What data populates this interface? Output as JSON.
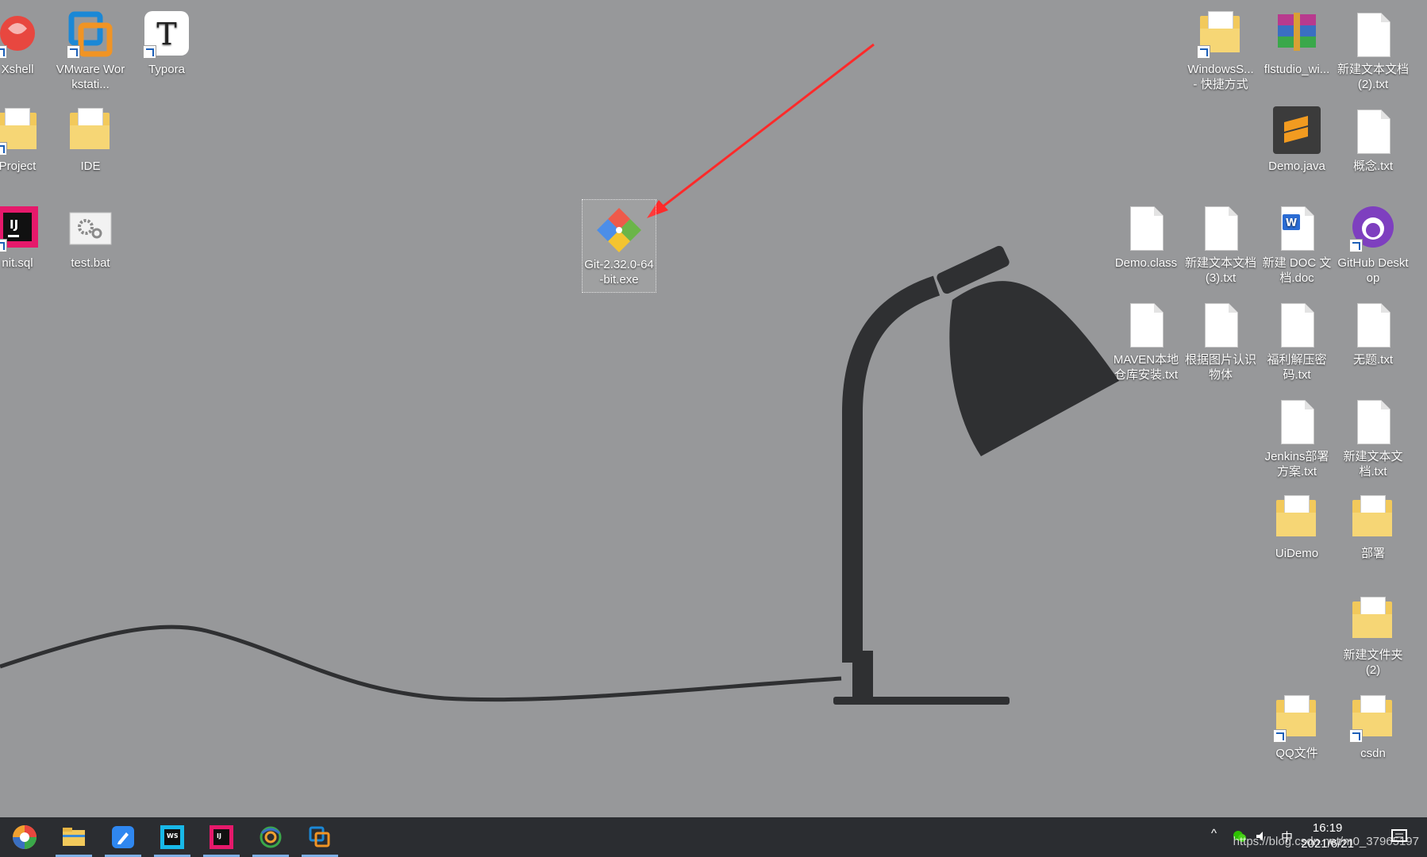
{
  "desktop": {
    "left_icons": [
      {
        "label": "Xshell",
        "icon": "xshell-icon"
      },
      {
        "label": "VMware Workstati...",
        "icon": "vmware-icon"
      },
      {
        "label": "Typora",
        "icon": "typora-icon"
      },
      {
        "label": "Project",
        "icon": "folder-icon"
      },
      {
        "label": "IDE",
        "icon": "folder-icon"
      },
      {
        "label": "nit.sql",
        "icon": "intellij-icon"
      },
      {
        "label": "test.bat",
        "icon": "gear-file-icon"
      }
    ],
    "center_icon": {
      "label": "Git-2.32.0-64-bit.exe",
      "icon": "git-installer-icon"
    },
    "right_icons": [
      {
        "label": "WindowsS... - 快捷方式",
        "icon": "folder-shortcut-icon"
      },
      {
        "label": "flstudio_wi...",
        "icon": "winrar-archive-icon"
      },
      {
        "label": "新建文本文档 (2).txt",
        "icon": "text-file-icon"
      },
      {
        "label": "Demo.java",
        "icon": "sublime-icon"
      },
      {
        "label": "概念.txt",
        "icon": "text-file-icon"
      },
      {
        "label": "Demo.class",
        "icon": "blank-file-icon"
      },
      {
        "label": "新建文本文档 (3).txt",
        "icon": "text-file-icon"
      },
      {
        "label": "新建 DOC 文档.doc",
        "icon": "word-doc-icon"
      },
      {
        "label": "GitHub Desktop",
        "icon": "github-icon"
      },
      {
        "label": "MAVEN本地仓库安装.txt",
        "icon": "text-file-icon"
      },
      {
        "label": "根据图片认识物体",
        "icon": "text-file-icon"
      },
      {
        "label": "福利解压密码.txt",
        "icon": "text-file-icon"
      },
      {
        "label": "无题.txt",
        "icon": "text-file-icon"
      },
      {
        "label": "Jenkins部署方案.txt",
        "icon": "text-file-icon"
      },
      {
        "label": "新建文本文档.txt",
        "icon": "text-file-icon"
      },
      {
        "label": "UiDemo",
        "icon": "folder-icon"
      },
      {
        "label": "部署",
        "icon": "folder-icon"
      },
      {
        "label": "新建文件夹 (2)",
        "icon": "folder-icon"
      },
      {
        "label": "QQ文件",
        "icon": "folder-shortcut-icon"
      },
      {
        "label": "csdn",
        "icon": "folder-shortcut-icon"
      }
    ]
  },
  "taskbar": {
    "apps": [
      {
        "icon": "start-colorful-icon",
        "running": false
      },
      {
        "icon": "file-explorer-icon",
        "running": true
      },
      {
        "icon": "note-editor-icon",
        "running": true
      },
      {
        "icon": "webstorm-icon",
        "running": true
      },
      {
        "icon": "intellij-icon",
        "running": true
      },
      {
        "icon": "browser-icon",
        "running": true
      },
      {
        "icon": "vmware-icon",
        "running": true
      }
    ],
    "tray": {
      "chevron": "^",
      "ime": "中",
      "time": "16:19",
      "date": "2021/6/21"
    },
    "watermark": "https://blog.csdn.net/m0_37965197"
  }
}
